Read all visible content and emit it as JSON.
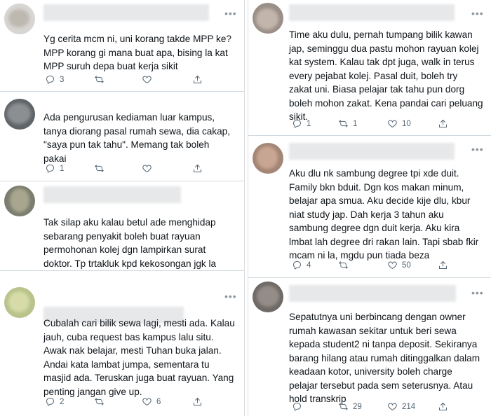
{
  "left_column": [
    {
      "text": "Yg cerita mcm ni, uni korang takde MPP ke?\nMPP korang gi mana buat apa, bising la kat\nMPP suruh depa buat kerja sikit",
      "reply_count": "3",
      "retweet_count": "",
      "like_count": ""
    },
    {
      "text": "Ada pengurusan kediaman luar kampus,\ntanya diorang pasal rumah sewa, dia cakap,\n\"saya pun tak tahu\". Memang tak boleh\npakai",
      "reply_count": "1",
      "retweet_count": "",
      "like_count": ""
    },
    {
      "text": "Tak silap aku kalau betul ade menghidap\nsebarang penyakit boleh buat rayuan\npermohonan kolej dgn lampirkan surat\ndoktor. Tp trtakluk kpd kekosongan jgk la",
      "reply_count": "",
      "retweet_count": "",
      "like_count": ""
    },
    {
      "text": "Cubalah cari bilik sewa lagi, mesti ada. Kalau\njauh, cuba request bas kampus lalu situ.\nAwak nak belajar, mesti Tuhan buka jalan.\nAndai kata lambat jumpa, sementara tu\nmasjid ada. Teruskan juga buat rayuan. Yang\npenting jangan give up.",
      "reply_count": "2",
      "retweet_count": "",
      "like_count": "6"
    }
  ],
  "right_column": [
    {
      "text": "Time aku dulu, pernah tumpang bilik kawan\njap, seminggu dua pastu mohon rayuan kolej\nkat system. Kalau tak dpt juga, walk in terus\nevery pejabat kolej. Pasal duit, boleh try\nzakat uni. Biasa pelajar tak tahu pun dorg\nboleh mohon zakat. Kena pandai cari peluang\nsikit.",
      "reply_count": "1",
      "retweet_count": "1",
      "like_count": "10"
    },
    {
      "text": "Aku dlu nk sambung degree tpi xde duit.\nFamily bkn bduit. Dgn kos makan minum,\nbelajar apa smua. Aku decide kije dlu, kbur\nniat study jap. Dah kerja 3 tahun aku\nsambung degree dgn duit kerja. Aku kira\nlmbat lah degree dri rakan lain. Tapi sbab fkir\nmcam ni la, mgdu pun tiada beza",
      "reply_count": "4",
      "retweet_count": "",
      "like_count": "50"
    },
    {
      "text": "Sepatutnya uni berbincang dengan owner\nrumah kawasan sekitar untuk beri sewa\nkepada student2 ni tanpa deposit. Sekiranya\nbarang hilang atau rumah ditinggalkan dalam\nkeadaan kotor, university boleh charge\npelajar tersebut pada sem seterusnya. Atau\nhold transkrip",
      "reply_count": "",
      "retweet_count": "29",
      "like_count": "214"
    }
  ],
  "more_glyph": "•••",
  "colors": {
    "text": "#0f1419",
    "muted": "#536471",
    "divider": "#cfd9de"
  }
}
